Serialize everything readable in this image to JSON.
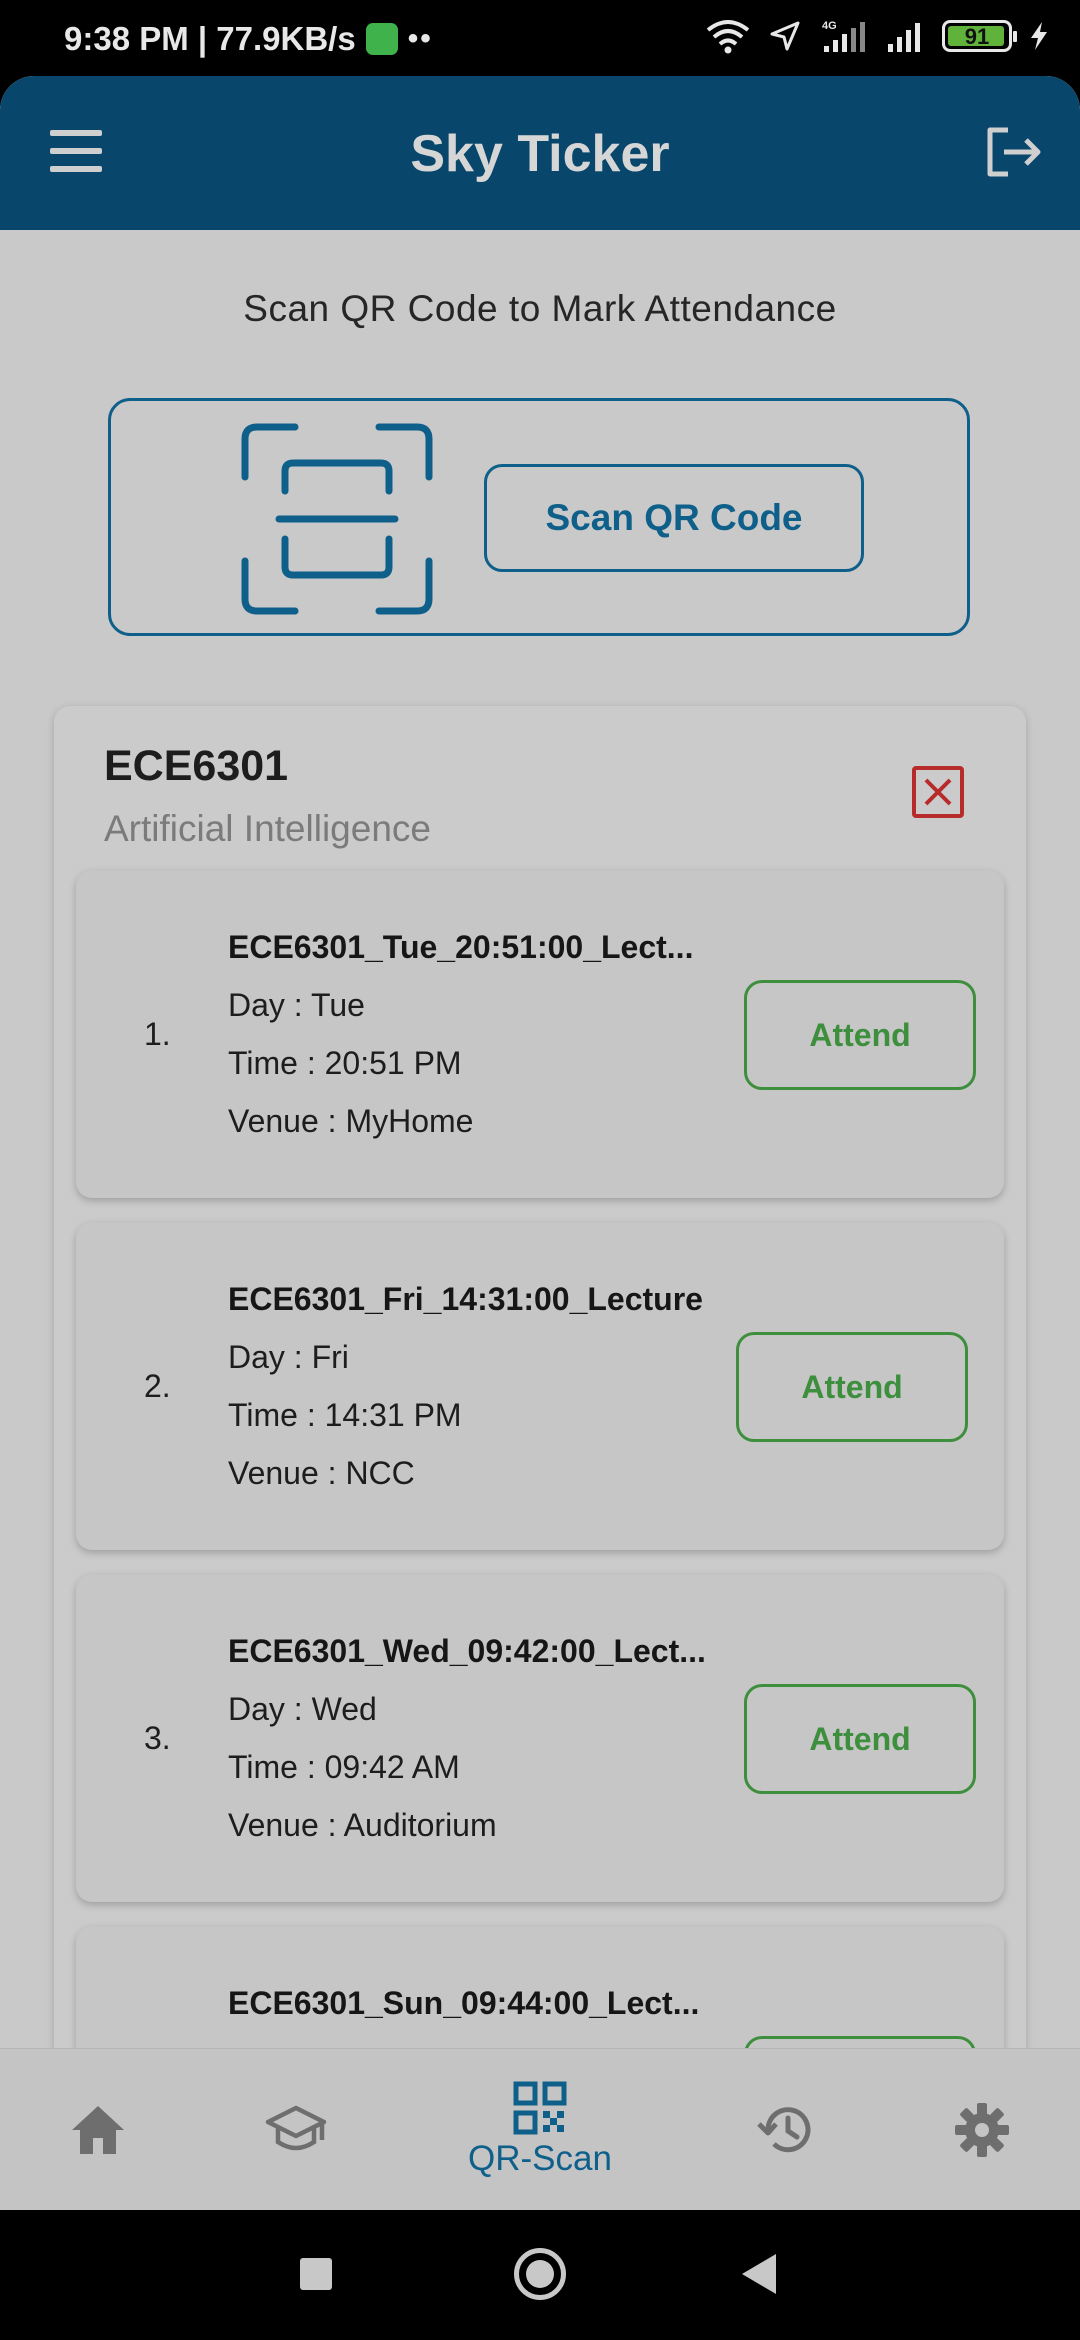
{
  "status_bar": {
    "time_speed": "9:38 PM | 77.9KB/s",
    "dots": "••",
    "network_type": "4G",
    "battery_level": "91"
  },
  "app_bar": {
    "title": "Sky Ticker",
    "menu_icon": "hamburger-menu-icon",
    "logout_icon": "logout-icon"
  },
  "scan_section": {
    "heading": "Scan QR Code to Mark Attendance",
    "button_label": "Scan QR Code",
    "icon": "qr-scan-frame-icon"
  },
  "course": {
    "code": "ECE6301",
    "name": "Artificial Intelligence",
    "remove_icon": "close-box-icon",
    "sessions": [
      {
        "index": "1.",
        "title": "ECE6301_Tue_20:51:00_Lect...",
        "day": "Day : Tue",
        "time": "Time : 20:51 PM",
        "venue": "Venue : MyHome",
        "button": "Attend"
      },
      {
        "index": "2.",
        "title": "ECE6301_Fri_14:31:00_Lecture",
        "day": "Day : Fri",
        "time": "Time : 14:31 PM",
        "venue": "Venue : NCC",
        "button": "Attend"
      },
      {
        "index": "3.",
        "title": "ECE6301_Wed_09:42:00_Lect...",
        "day": "Day : Wed",
        "time": "Time : 09:42 AM",
        "venue": "Venue : Auditorium",
        "button": "Attend"
      },
      {
        "index": "",
        "title": "ECE6301_Sun_09:44:00_Lect...",
        "day": "",
        "time": "",
        "venue": "",
        "button": ""
      }
    ]
  },
  "bottom_nav": {
    "items": [
      {
        "icon": "home-icon",
        "label": ""
      },
      {
        "icon": "graduation-cap-icon",
        "label": ""
      },
      {
        "icon": "qr-code-icon",
        "label": "QR-Scan",
        "active": true
      },
      {
        "icon": "history-icon",
        "label": ""
      },
      {
        "icon": "settings-gear-icon",
        "label": ""
      }
    ]
  },
  "colors": {
    "primary": "#08466c",
    "accent_blue": "#0e5f8a",
    "attend_green": "#3d8f3d",
    "close_red": "#b82b2b",
    "background": "#c9c9c9"
  }
}
